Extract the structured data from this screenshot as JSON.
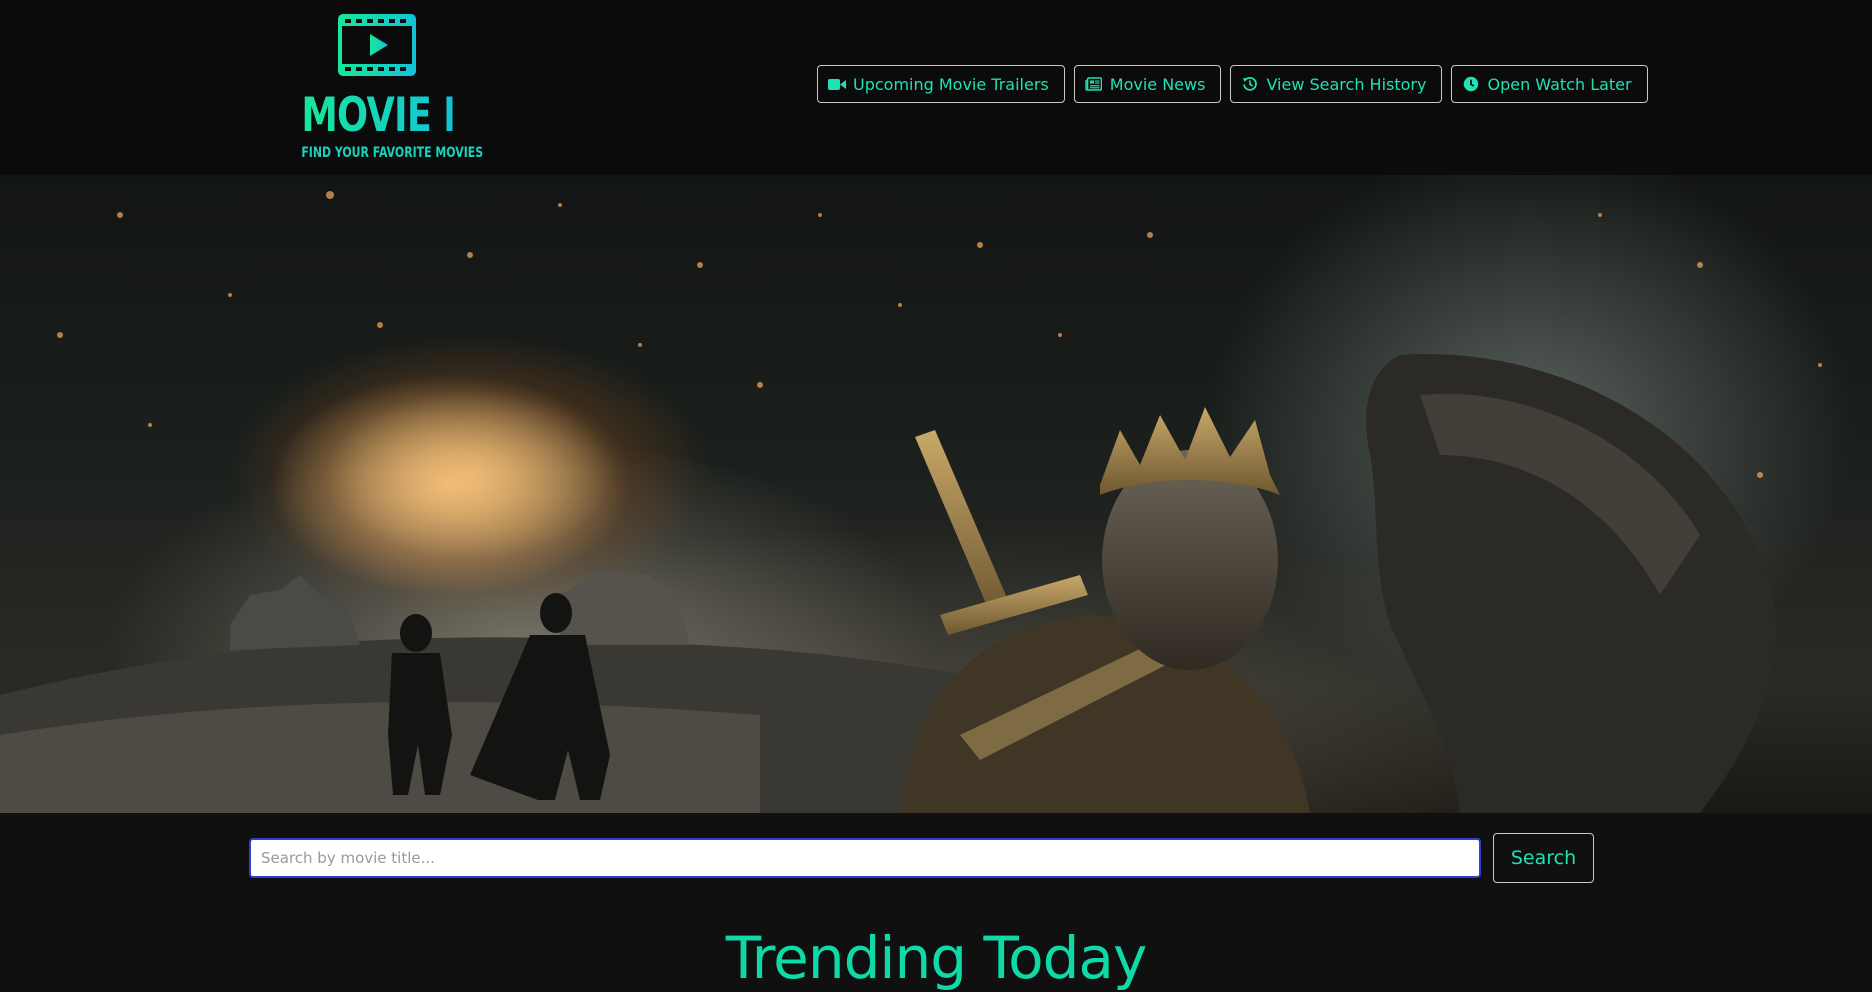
{
  "brand": {
    "title": "MOVIE BUFF",
    "tagline": "FIND YOUR FAVORITE MOVIES",
    "logo_icon": "film-play-icon"
  },
  "nav": {
    "items": [
      {
        "label": "Upcoming Movie Trailers",
        "icon": "video-camera-icon"
      },
      {
        "label": "Movie News",
        "icon": "newspaper-icon"
      },
      {
        "label": "View Search History",
        "icon": "history-icon"
      },
      {
        "label": "Open Watch Later",
        "icon": "clock-icon"
      }
    ]
  },
  "search": {
    "placeholder": "Search by movie title...",
    "value": "",
    "button_label": "Search"
  },
  "section": {
    "heading": "Trending Today"
  },
  "colors": {
    "accent": "#1fe1b6",
    "background": "#101010",
    "header_background": "#0b0b0b",
    "input_border": "#2f3fcf"
  }
}
